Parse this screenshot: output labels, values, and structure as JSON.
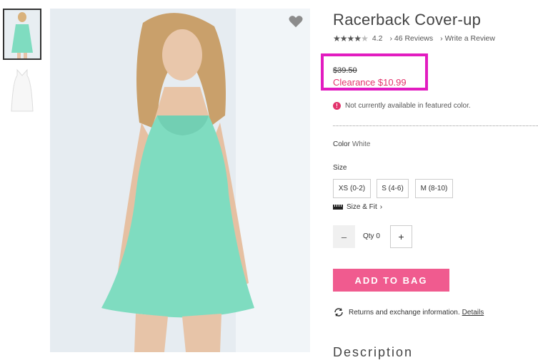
{
  "gallery": {
    "thumbnails": [
      "thumbnail-model",
      "thumbnail-product"
    ],
    "favorite_icon": "heart-icon"
  },
  "product": {
    "title": "Racerback Cover-up",
    "rating": "4.2",
    "stars_filled": 4,
    "reviews_link": "46 Reviews",
    "write_review_link": "Write a Review",
    "original_price": "$39.50",
    "clearance_price": "Clearance $10.99",
    "availability_notice": "Not currently available in featured color.",
    "color_label": "Color",
    "color_value": "White",
    "size_label": "Size",
    "sizes": [
      "XS (0-2)",
      "S (4-6)",
      "M (8-10)"
    ],
    "size_fit_link": "Size & Fit",
    "qty_label": "Qty 0",
    "qty_minus": "–",
    "qty_plus": "+",
    "add_to_bag": "ADD TO BAG",
    "returns_text": "Returns and exchange information.",
    "returns_link": "Details",
    "description_heading": "Description"
  },
  "colors": {
    "accent": "#f05b8f",
    "sale": "#e3336c",
    "highlight_box": "#e21cc0",
    "dress": "#7fdcc0"
  }
}
